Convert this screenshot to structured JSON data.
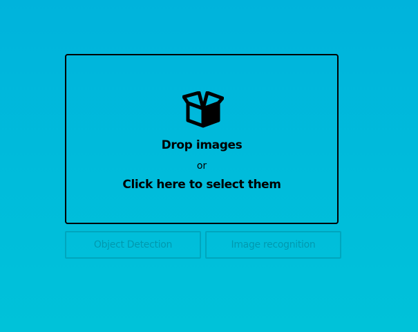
{
  "dropzone": {
    "icon": "open-box-icon",
    "title": "Drop images",
    "or_text": "or",
    "select_text": "Click here to select them"
  },
  "modes": {
    "object_detection": "Object Detection",
    "image_recognition": "Image recognition"
  },
  "colors": {
    "background": "#00b8dc",
    "border": "#000000"
  }
}
